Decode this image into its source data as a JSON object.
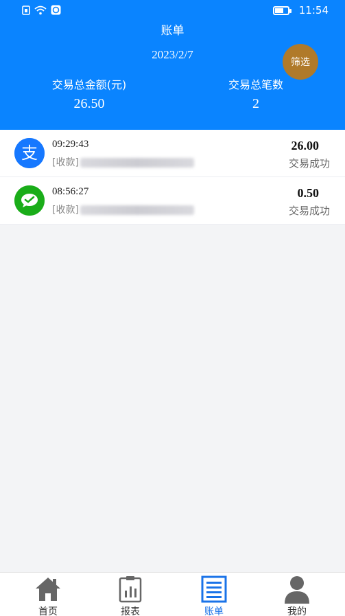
{
  "status_bar": {
    "time": "11:54"
  },
  "header": {
    "title": "账单",
    "date": "2023/2/7",
    "filter_label": "筛选",
    "total_amount_label": "交易总金额(元)",
    "total_amount_value": "26.50",
    "total_count_label": "交易总笔数",
    "total_count_value": "2"
  },
  "transactions": [
    {
      "icon": "alipay-icon",
      "time": "09:29:43",
      "desc_prefix": "[收款]",
      "amount": "26.00",
      "status": "交易成功"
    },
    {
      "icon": "wechat-pay-icon",
      "time": "08:56:27",
      "desc_prefix": "[收款]",
      "amount": "0.50",
      "status": "交易成功"
    }
  ],
  "tabs": [
    {
      "label": "首页",
      "icon": "home-icon"
    },
    {
      "label": "报表",
      "icon": "report-icon"
    },
    {
      "label": "账单",
      "icon": "bill-icon"
    },
    {
      "label": "我的",
      "icon": "user-icon"
    }
  ],
  "colors": {
    "header_bg": "#0a84ff",
    "filter_bg": "#b07a2a",
    "alipay": "#1678ff",
    "wechat": "#1aad19",
    "active_tab": "#1a73e8"
  },
  "active_tab": "账单"
}
